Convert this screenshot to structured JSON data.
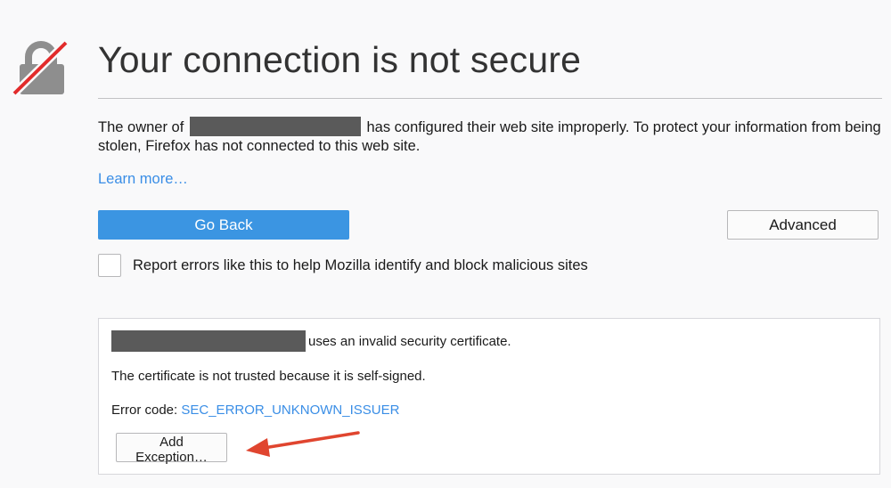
{
  "page": {
    "title": "Your connection is not secure",
    "icon": "broken-lock-icon"
  },
  "intro": {
    "before_host": "The owner of",
    "after_host": "has configured their web site improperly. To protect your information from being stolen, Firefox has not connected to this web site."
  },
  "links": {
    "learn_more": "Learn more…"
  },
  "buttons": {
    "go_back": "Go Back",
    "advanced": "Advanced",
    "add_exception": "Add Exception…"
  },
  "report": {
    "label": "Report errors like this to help Mozilla identify and block malicious sites",
    "checked": false
  },
  "advanced_panel": {
    "cert_message": "uses an invalid security certificate.",
    "reason": "The certificate is not trusted because it is self-signed.",
    "error_label": "Error code:",
    "error_code": "SEC_ERROR_UNKNOWN_ISSUER"
  },
  "colors": {
    "accent_blue": "#3b95e2",
    "link_blue": "#3a8ee6",
    "strike_red": "#e22b2b",
    "annotation_red": "#e0452f",
    "lock_gray": "#8e8e8e"
  }
}
